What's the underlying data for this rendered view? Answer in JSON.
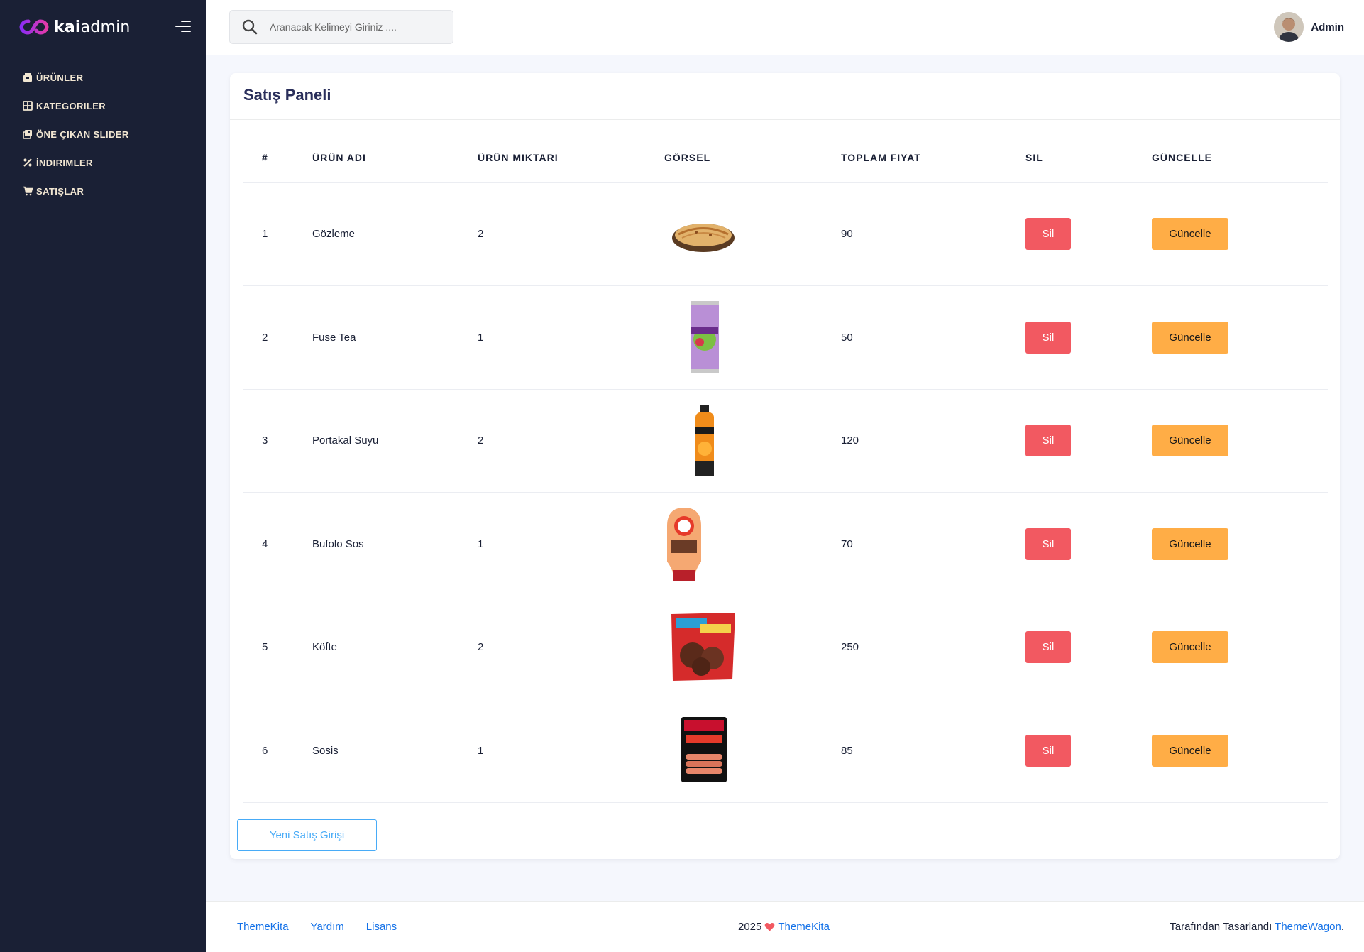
{
  "brand": {
    "part1": "kai",
    "part2": "admin",
    "accent": "#7c3aed"
  },
  "sidebar": {
    "items": [
      {
        "label": "ÜRÜNLER",
        "icon": "box-icon"
      },
      {
        "label": "KATEGORILER",
        "icon": "grid-icon"
      },
      {
        "label": "ÖNE ÇIKAN SLIDER",
        "icon": "images-icon"
      },
      {
        "label": "İNDIRIMLER",
        "icon": "percent-icon"
      },
      {
        "label": "SATIŞLAR",
        "icon": "cart-icon"
      }
    ]
  },
  "search": {
    "placeholder": "Aranacak Kelimeyi Giriniz ...."
  },
  "user": {
    "name": "Admin"
  },
  "card": {
    "title": "Satış Paneli"
  },
  "table": {
    "headers": [
      "#",
      "ÜRÜN ADI",
      "ÜRÜN MIKTARI",
      "GÖRSEL",
      "TOPLAM FIYAT",
      "SIL",
      "GÜNCELLE"
    ],
    "rows": [
      {
        "no": "1",
        "name": "Gözleme",
        "qty": "2",
        "image": "gozleme-image",
        "total": "90",
        "delete": "Sil",
        "update": "Güncelle"
      },
      {
        "no": "2",
        "name": "Fuse Tea",
        "qty": "1",
        "image": "fuse-tea-image",
        "total": "50",
        "delete": "Sil",
        "update": "Güncelle"
      },
      {
        "no": "3",
        "name": "Portakal Suyu",
        "qty": "2",
        "image": "orange-juice-image",
        "total": "120",
        "delete": "Sil",
        "update": "Güncelle"
      },
      {
        "no": "4",
        "name": "Bufolo Sos",
        "qty": "1",
        "image": "sauce-bottle-image",
        "total": "70",
        "delete": "Sil",
        "update": "Güncelle"
      },
      {
        "no": "5",
        "name": "Köfte",
        "qty": "2",
        "image": "meatball-pack-image",
        "total": "250",
        "delete": "Sil",
        "update": "Güncelle"
      },
      {
        "no": "6",
        "name": "Sosis",
        "qty": "1",
        "image": "sausage-pack-image",
        "total": "85",
        "delete": "Sil",
        "update": "Güncelle"
      }
    ]
  },
  "new_sale_button": "Yeni Satış Girişi",
  "footer": {
    "links": [
      "ThemeKita",
      "Yardım",
      "Lisans"
    ],
    "year": "2025",
    "center_link": "ThemeKita",
    "designed_by": "Tarafından Tasarlandı",
    "designer_link": "ThemeWagon",
    "designer_suffix": "."
  },
  "colors": {
    "sidebar_bg": "#1a2035",
    "danger": "#f25961",
    "warning": "#ffad46",
    "link": "#1572e8",
    "info": "#48abf7"
  }
}
